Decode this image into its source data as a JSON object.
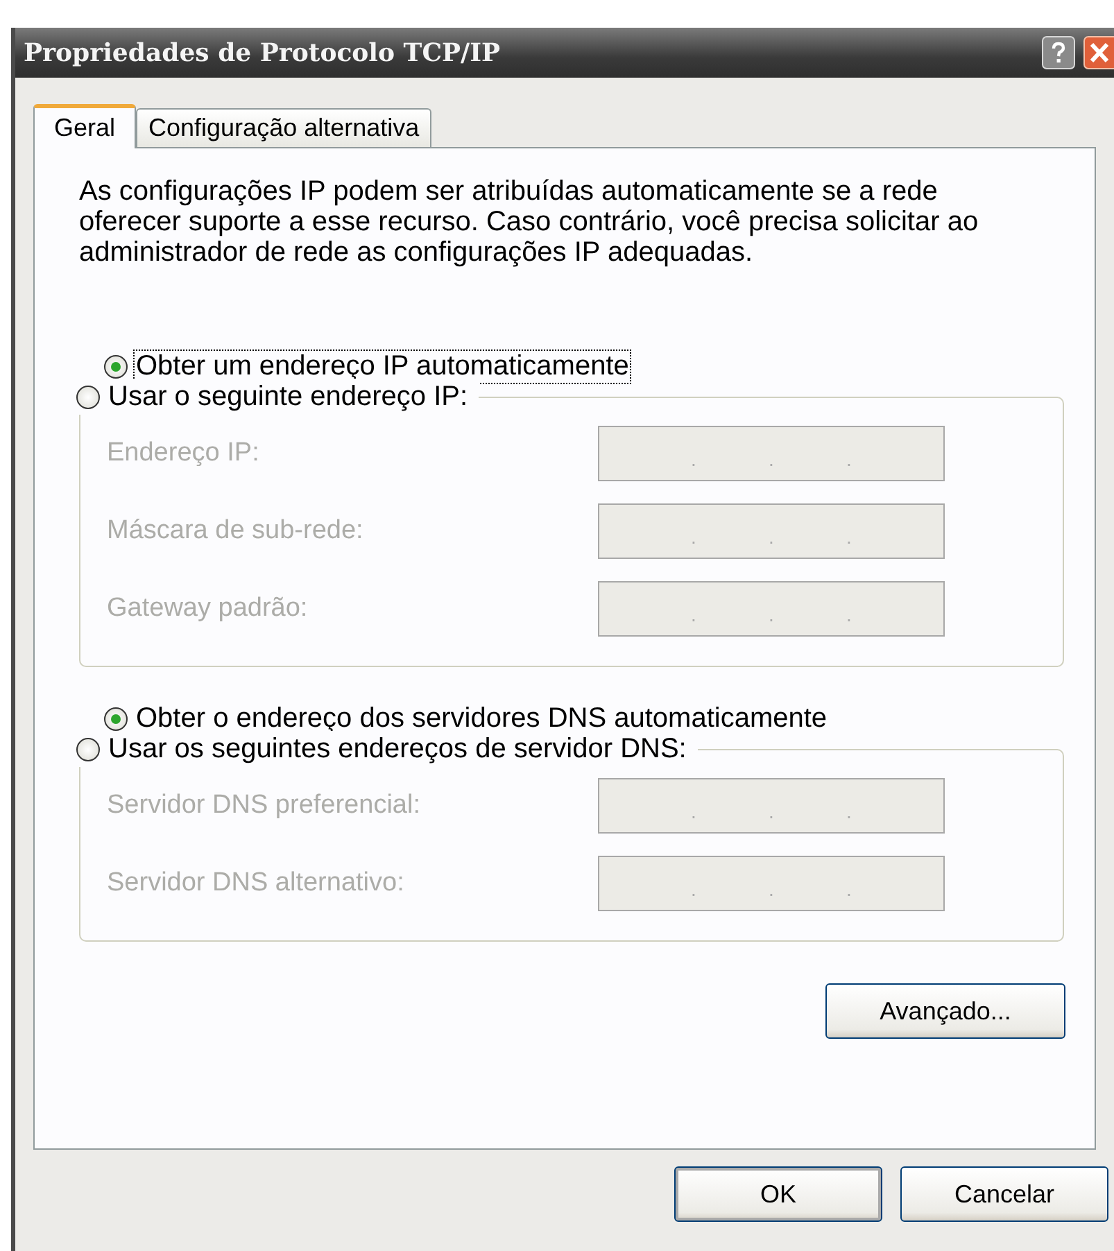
{
  "window": {
    "title": "Propriedades de Protocolo TCP/IP"
  },
  "tabs": [
    {
      "label": "Geral",
      "selected": true
    },
    {
      "label": "Configuração alternativa",
      "selected": false
    }
  ],
  "intro": "As configurações IP podem ser atribuídas automaticamente se a rede oferecer suporte a esse recurso. Caso contrário, você precisa solicitar ao administrador de rede as configurações IP adequadas.",
  "ip_section": {
    "options": [
      {
        "label": "Obter um endereço IP automaticamente",
        "selected": true,
        "focused": true
      },
      {
        "label": "Usar o seguinte endereço IP:",
        "selected": false,
        "focused": false
      }
    ],
    "disabled": true,
    "fields": [
      {
        "label": "Endereço IP:",
        "dots": [
          ".",
          ".",
          "."
        ]
      },
      {
        "label": "Máscara de sub-rede:",
        "dots": [
          ".",
          ".",
          "."
        ]
      },
      {
        "label": "Gateway padrão:",
        "dots": [
          ".",
          ".",
          "."
        ]
      }
    ]
  },
  "dns_section": {
    "options": [
      {
        "label": "Obter o endereço dos servidores DNS automaticamente",
        "selected": true,
        "focused": false
      },
      {
        "label": "Usar os seguintes endereços de servidor DNS:",
        "selected": false,
        "focused": false
      }
    ],
    "disabled": true,
    "fields": [
      {
        "label": "Servidor DNS preferencial:",
        "dots": [
          ".",
          ".",
          "."
        ]
      },
      {
        "label": "Servidor DNS alternativo:",
        "dots": [
          ".",
          ".",
          "."
        ]
      }
    ]
  },
  "advanced_button": "Avançado...",
  "buttons": [
    "OK",
    "Cancelar"
  ]
}
